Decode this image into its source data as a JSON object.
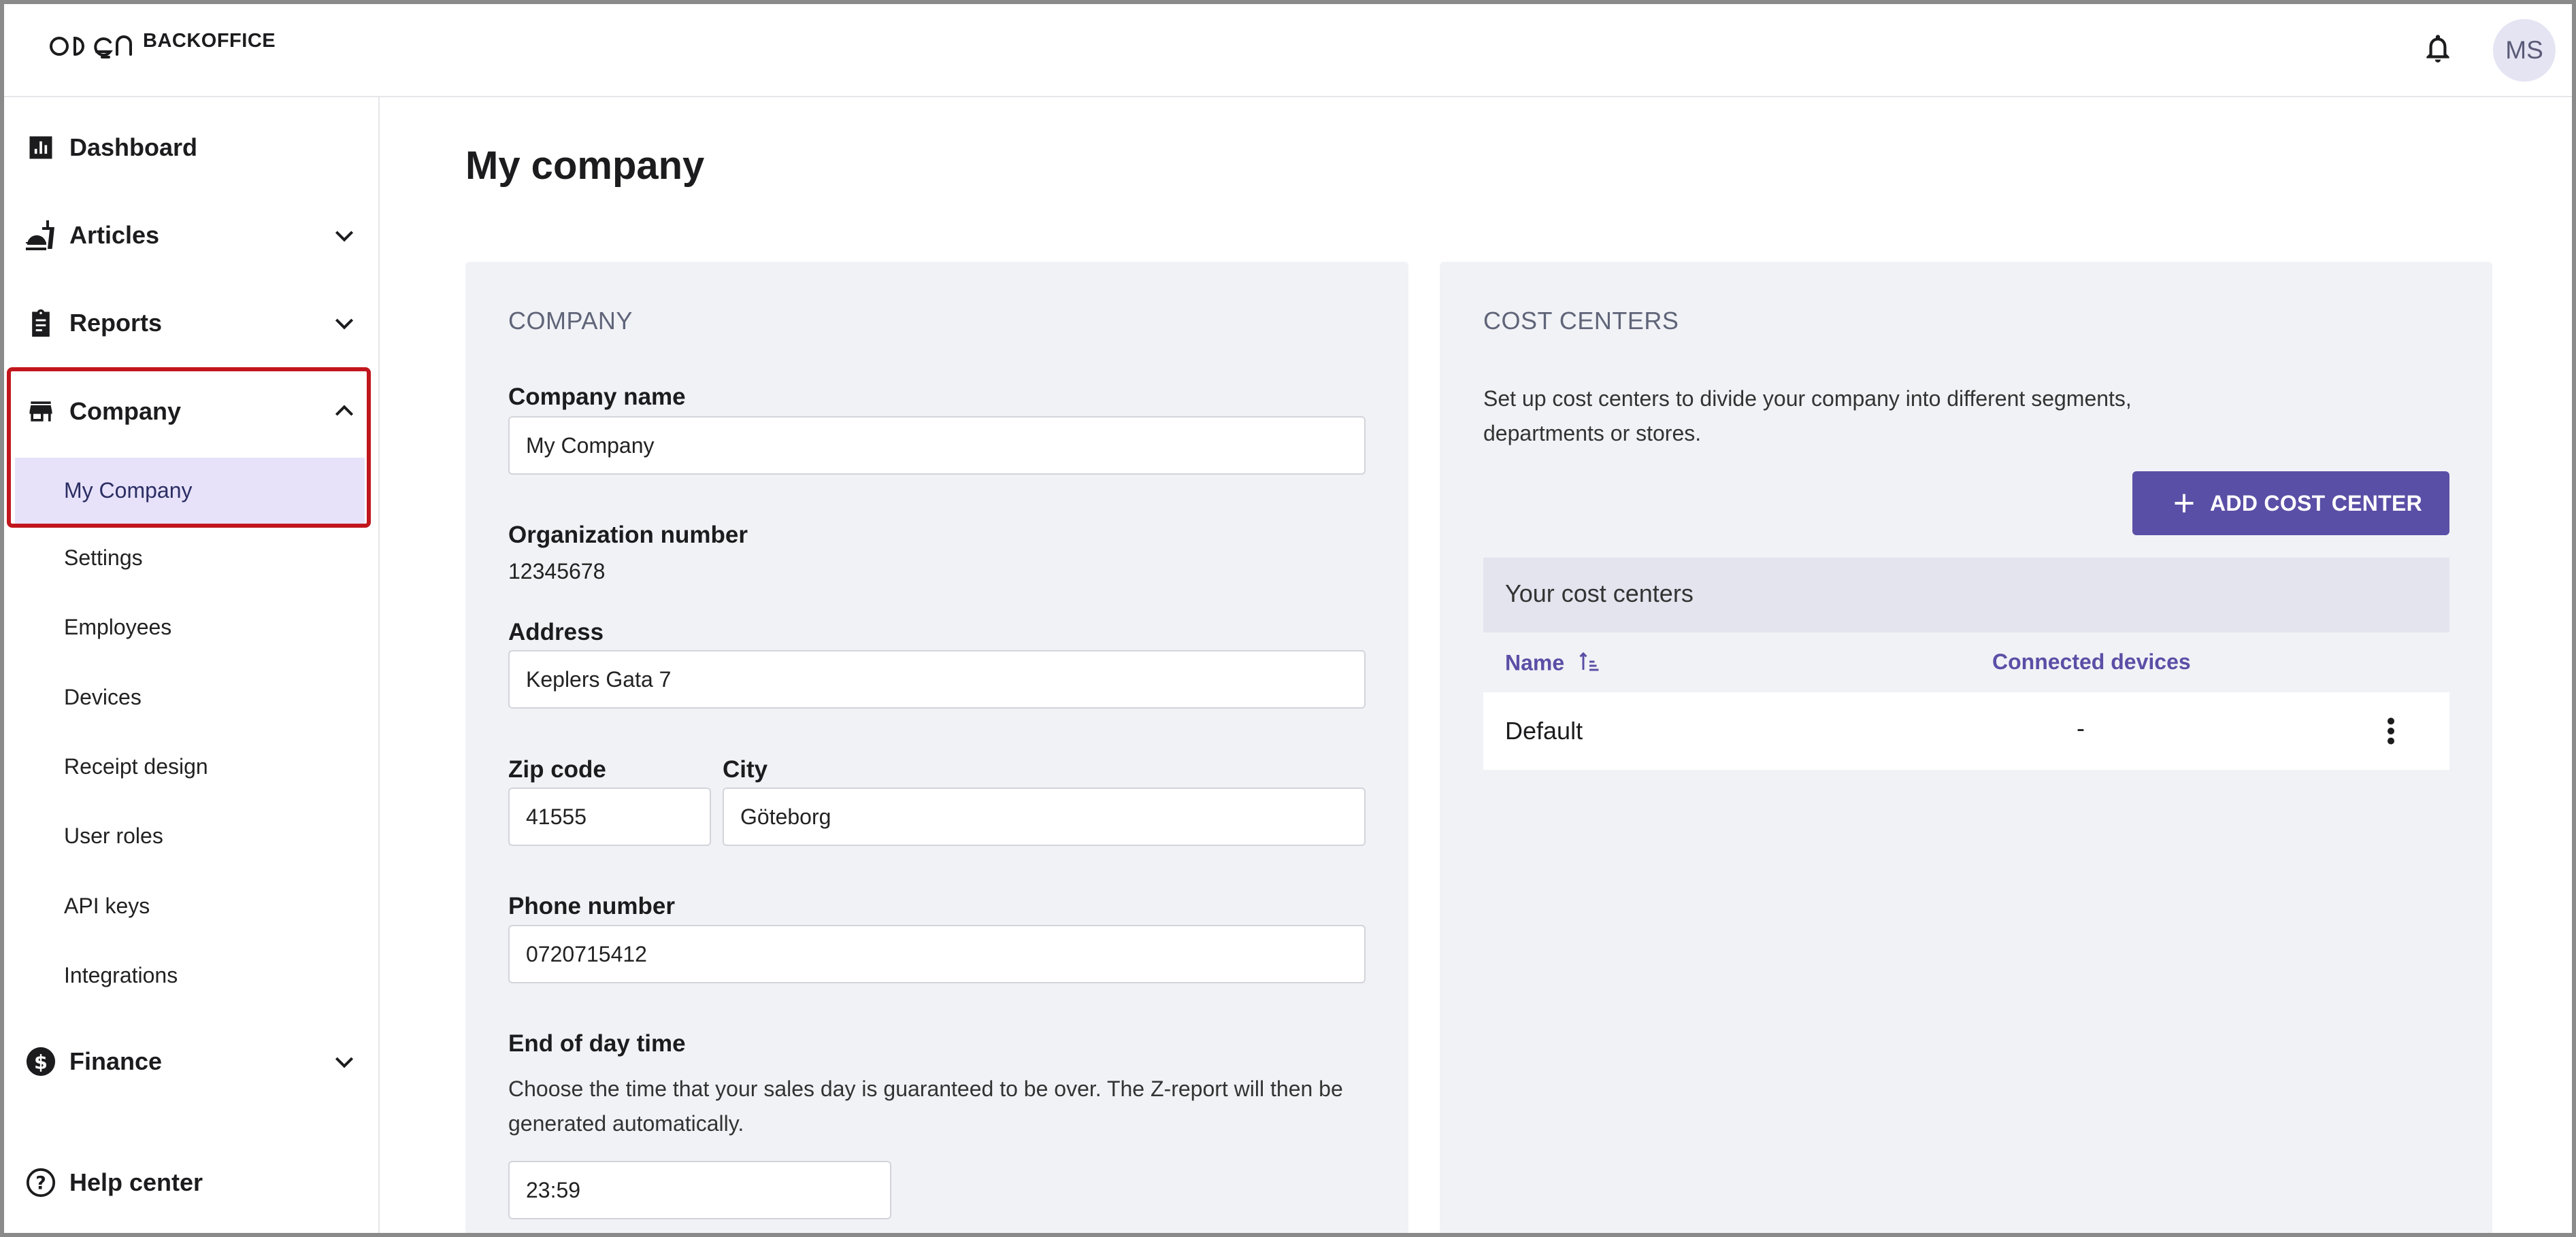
{
  "header": {
    "logo_text": "BACKOFFICE",
    "avatar_initials": "MS",
    "icons": {
      "logo": "open-logo-icon",
      "notifications": "bell-icon"
    }
  },
  "sidebar": {
    "items": [
      {
        "label": "Dashboard",
        "icon": "bar-chart-icon"
      },
      {
        "label": "Articles",
        "icon": "food-icon"
      },
      {
        "label": "Reports",
        "icon": "clipboard-icon"
      },
      {
        "label": "Company",
        "icon": "store-icon"
      },
      {
        "label": "Finance",
        "icon": "dollar-icon"
      },
      {
        "label": "Help center",
        "icon": "help-icon"
      }
    ],
    "company_sub": [
      "My Company",
      "Settings",
      "Employees",
      "Devices",
      "Receipt design",
      "User roles",
      "API keys",
      "Integrations"
    ]
  },
  "main": {
    "page_title": "My company",
    "company_card": {
      "section_title": "COMPANY",
      "company_name_label": "Company name",
      "company_name_value": "My Company",
      "org_number_label": "Organization number",
      "org_number_value": "12345678",
      "address_label": "Address",
      "address_value": "Keplers Gata 7",
      "zip_label": "Zip code",
      "zip_value": "41555",
      "city_label": "City",
      "city_value": "Göteborg",
      "phone_label": "Phone number",
      "phone_value": "0720715412",
      "eod_label": "End of day time",
      "eod_desc_line1": "Choose the time that your sales day is guaranteed to be over. The Z-report will then be",
      "eod_desc_line2": "generated automatically.",
      "eod_value": "23:59"
    },
    "cost_centers_card": {
      "section_title": "COST CENTERS",
      "desc_line1": "Set up cost centers to divide your company into different segments,",
      "desc_line2": "departments or stores.",
      "add_button": "ADD COST CENTER",
      "table_title": "Your cost centers",
      "columns": [
        "Name",
        "Connected devices"
      ],
      "rows": [
        {
          "name": "Default",
          "devices": "-"
        }
      ]
    }
  },
  "colors": {
    "accent": "#5a4fa6",
    "card_bg": "#f1f2f6",
    "active_bg": "#e7e2fa",
    "highlight_border": "#c2161d"
  }
}
